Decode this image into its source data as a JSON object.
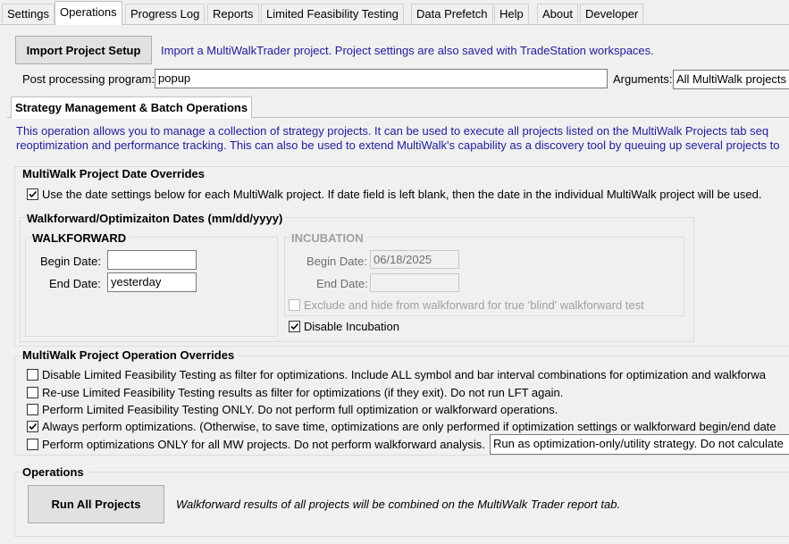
{
  "tabs": [
    "Settings",
    "Operations",
    "Progress Log",
    "Reports",
    "Limited Feasibility Testing",
    "Data Prefetch",
    "Help",
    "About",
    "Developer"
  ],
  "active_tab": "Operations",
  "import": {
    "button_label": "Import Project Setup",
    "description": "Import a MultiWalkTrader project.  Project settings are also saved with TradeStation workspaces."
  },
  "post_processing": {
    "label": "Post processing program:",
    "value": "popup",
    "arguments_label": "Arguments:",
    "arguments_value": "All MultiWalk projects"
  },
  "sub_tab": "Strategy Management & Batch Operations",
  "intro": {
    "line1": "This operation allows you to manage a collection of strategy projects.  It can be used to execute all projects listed on the MultiWalk Projects tab seq",
    "line2": "reoptimization and performance tracking.  This can also be used to extend MultiWalk's capability as a discovery tool by queuing up several projects to"
  },
  "date_overrides": {
    "title": "MultiWalk Project Date Overrides",
    "use_dates_label": "Use the date settings below for each MultiWalk project.  If date field is left blank, then the date in the individual MultiWalk project will be used.",
    "use_dates_checked": true,
    "wf_dates_title": "Walkforward/Optimizaiton Dates (mm/dd/yyyy)",
    "walkforward": {
      "title": "WALKFORWARD",
      "begin_label": "Begin Date:",
      "begin_value": "",
      "end_label": "End Date:",
      "end_value": "yesterday"
    },
    "incubation": {
      "title": "INCUBATION",
      "begin_label": "Begin Date:",
      "begin_value": "06/18/2025",
      "end_label": "End Date:",
      "end_value": "",
      "exclude_label": "Exclude and hide from walkforward for true 'blind' walkforward test",
      "exclude_checked": false,
      "disable_label": "Disable Incubation",
      "disable_checked": true
    }
  },
  "operation_overrides": {
    "title": "MultiWalk Project Operation Overrides",
    "options": [
      {
        "label": "Disable Limited Feasibility Testing as filter for optimizations. Include ALL symbol and bar interval combinations for optimization and walkforwa",
        "checked": false
      },
      {
        "label": "Re-use Limited Feasibility Testing results as filter for optimizations (if they exit).  Do not run LFT again.",
        "checked": false
      },
      {
        "label": "Perform Limited Feasibility Testing ONLY.  Do not perform full optimization or walkforward operations.",
        "checked": false
      },
      {
        "label": "Always perform optimizations. (Otherwise, to save time, optimizations are only performed if optimization settings or walkforward begin/end date",
        "checked": true
      },
      {
        "label": "Perform optimizations ONLY for all MW projects. Do not perform walkforward analysis.",
        "checked": false
      }
    ],
    "optimization_only_value": "Run as optimization-only/utility strategy. Do not calculate"
  },
  "operations": {
    "title": "Operations",
    "run_button_label": "Run All Projects",
    "note": "Walkforward results of all projects will be combined on the MultiWalk Trader report tab."
  }
}
